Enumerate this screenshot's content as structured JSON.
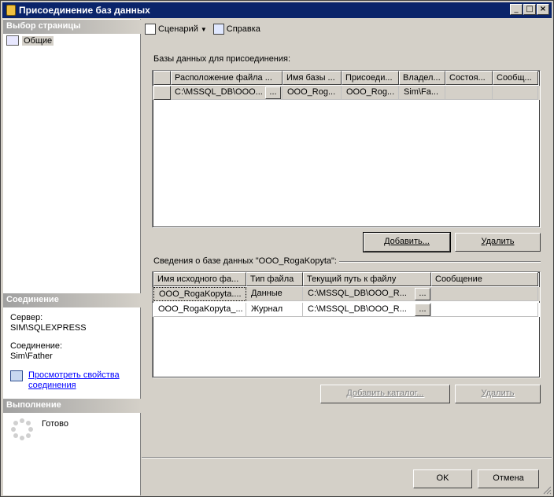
{
  "window": {
    "title": "Присоединение баз данных"
  },
  "left": {
    "select_page_header": "Выбор страницы",
    "pages": [
      {
        "label": "Общие"
      }
    ],
    "connection_header": "Соединение",
    "server_label": "Сервер:",
    "server_value": "SIM\\SQLEXPRESS",
    "connection_label": "Соединение:",
    "connection_value": "Sim\\Father",
    "view_props_link_line1": "Просмотреть свойства",
    "view_props_link_line2": "соединения",
    "progress_header": "Выполнение",
    "progress_status": "Готово"
  },
  "toolbar": {
    "script_label": "Сценарий",
    "help_label": "Справка"
  },
  "attach": {
    "group_label": "Базы данных для присоединения:",
    "columns": [
      "Расположение файла ...",
      "Имя базы ...",
      "Присоеди...",
      "Владел...",
      "Состоя...",
      "Сообщ..."
    ],
    "rows": [
      {
        "location": "C:\\MSSQL_DB\\OOO...",
        "db_name": "OOO_Rog...",
        "attach_as": "OOO_Rog...",
        "owner": "Sim\\Fa...",
        "status": "",
        "message": ""
      }
    ],
    "ellipsis": "...",
    "add_button": "Добавить...",
    "remove_button": "Удалить"
  },
  "details": {
    "group_label": "Сведения о базе данных \"OOO_RogaKopyta\":",
    "columns": [
      "Имя исходного фа...",
      "Тип файла",
      "Текущий путь к файлу",
      "Сообщение"
    ],
    "rows": [
      {
        "name": "OOO_RogaKopyta....",
        "type": "Данные",
        "path": "C:\\MSSQL_DB\\OOO_R...",
        "message": ""
      },
      {
        "name": "OOO_RogaKopyta_...",
        "type": "Журнал",
        "path": "C:\\MSSQL_DB\\OOO_R...",
        "message": ""
      }
    ],
    "ellipsis": "...",
    "add_catalog_button": "Добавить каталог...",
    "remove_button": "Удалить"
  },
  "footer": {
    "ok_button": "OK",
    "cancel_button": "Отмена"
  },
  "colors": {
    "titlebar": "#0a246a",
    "face": "#d4d0c8",
    "selection": "#d4d0c8",
    "link": "#0000ff"
  }
}
